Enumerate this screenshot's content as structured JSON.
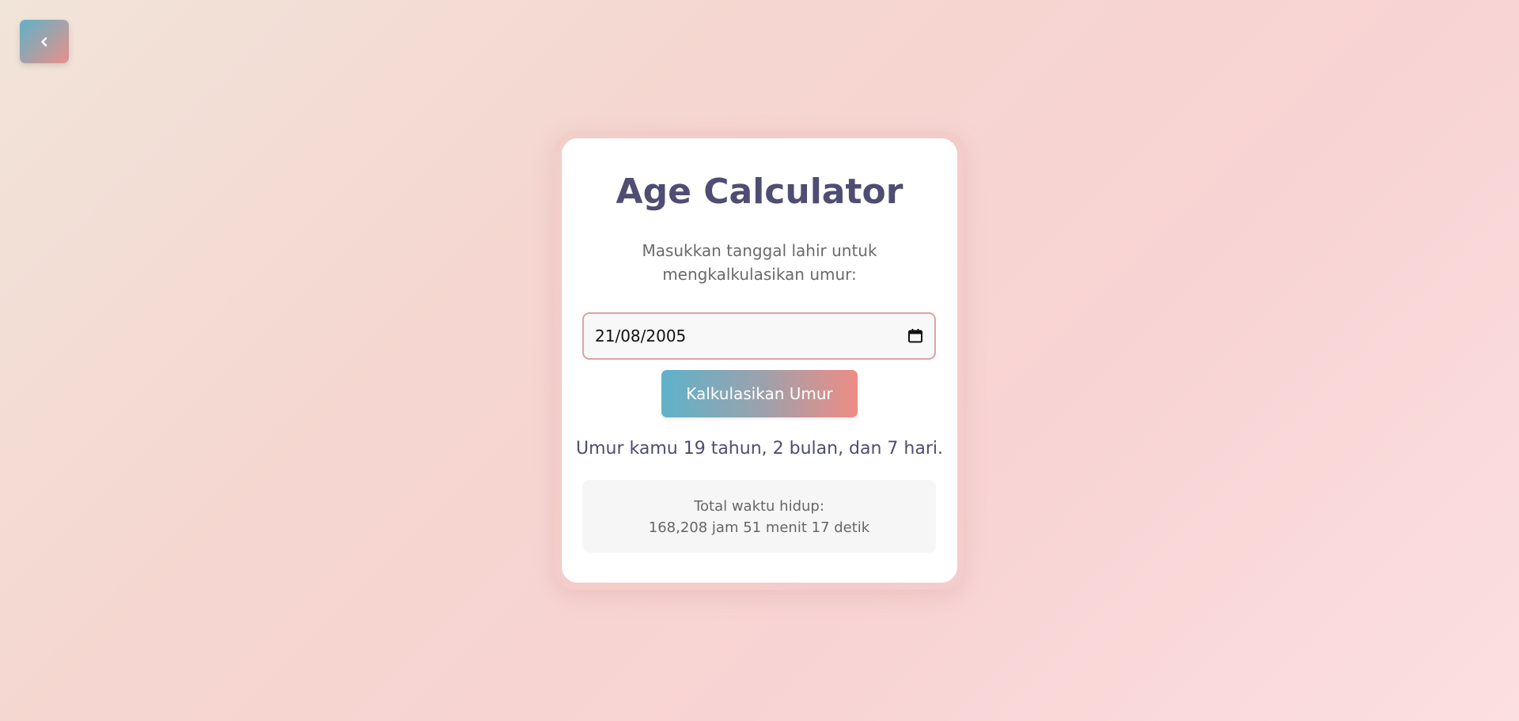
{
  "back_button": {
    "icon": "chevron-left-icon",
    "colors": [
      "#5fb2c9",
      "#e8908a"
    ]
  },
  "card": {
    "title": "Age Calculator",
    "subtitle": "Masukkan tanggal lahir untuk mengkalkulasikan umur:",
    "date_input": {
      "value": "21/08/2005",
      "icon": "calendar-icon"
    },
    "calculate_button": {
      "label": "Kalkulasikan Umur",
      "colors": [
        "#5fb2c9",
        "#ee8c84"
      ]
    },
    "result": "Umur kamu 19 tahun, 2 bulan, dan 7 hari.",
    "total": {
      "label": "Total waktu hidup:",
      "value": "168,208 jam 51 menit 17 detik"
    }
  },
  "colors": {
    "title": "#4e4d72",
    "accent_blue": "#5fb2c9",
    "accent_pink": "#ee8c84"
  }
}
